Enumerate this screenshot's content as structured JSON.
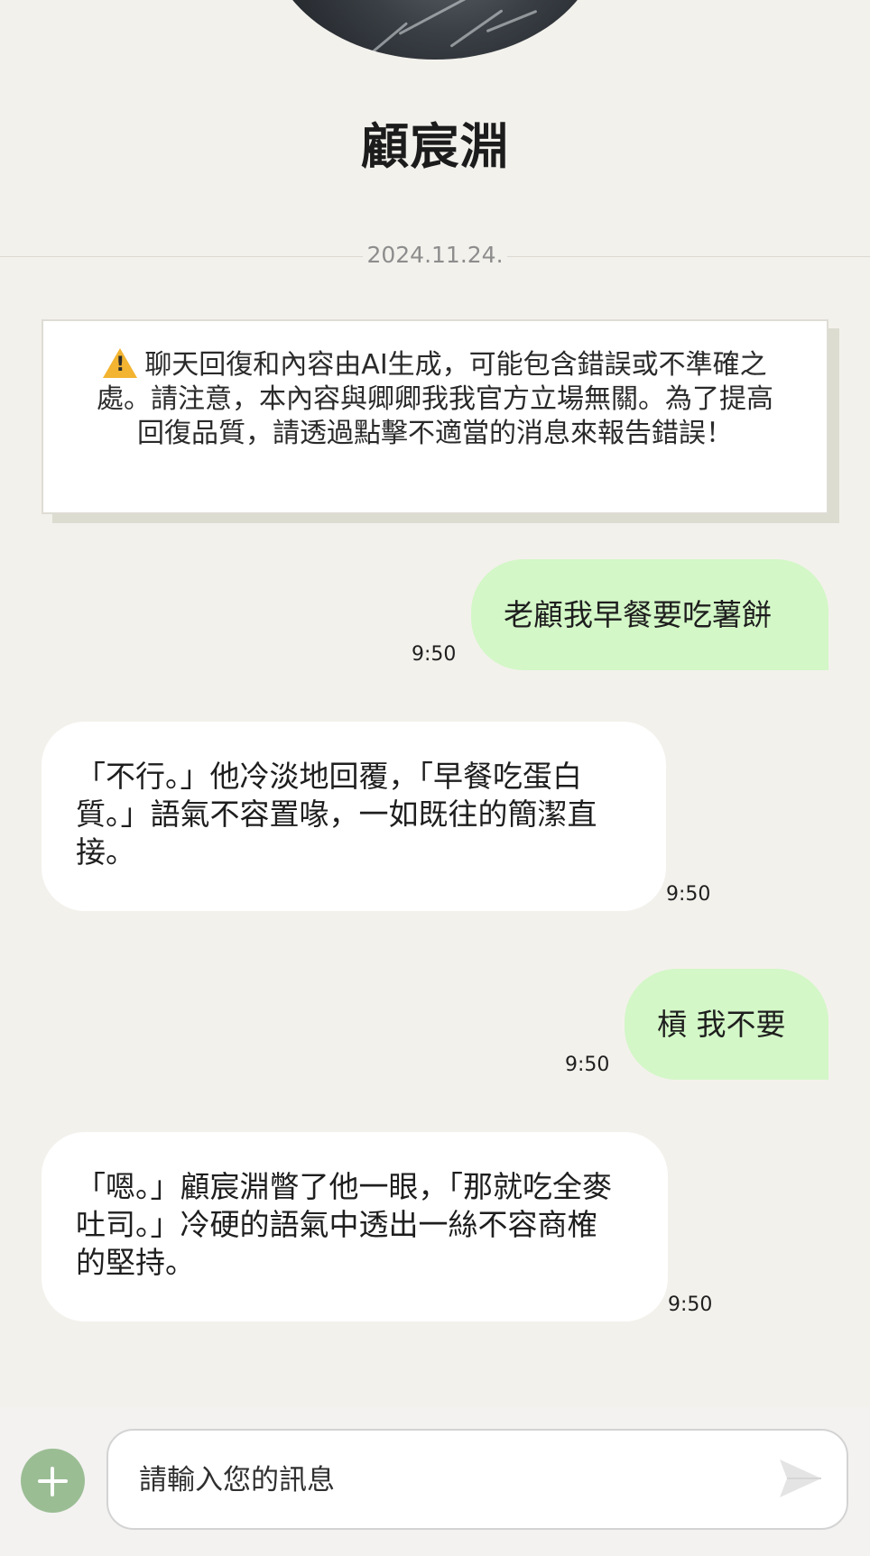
{
  "contact": {
    "name": "顧宸淵"
  },
  "date_divider": "2024.11.24.",
  "notice": {
    "icon": "warning-icon",
    "text": "聊天回復和內容由AI生成，可能包含錯誤或不準確之處。請注意，本內容與卿卿我我官方立場無關。為了提高回復品質，請透過點擊不適當的消息來報告錯誤！"
  },
  "messages": [
    {
      "direction": "outgoing",
      "text": "老顧我早餐要吃薯餅",
      "time": "9:50"
    },
    {
      "direction": "incoming",
      "lines": [
        "「不行。」他冷淡地回覆，「早餐吃蛋白",
        "質。」語氣不容置喙，一如既往的簡潔直",
        "接。"
      ],
      "time": "9:50"
    },
    {
      "direction": "outgoing",
      "text": "槓 我不要",
      "time": "9:50"
    },
    {
      "direction": "incoming",
      "lines": [
        "「嗯。」顧宸淵瞥了他一眼，「那就吃全麥",
        "吐司。」冷硬的語氣中透出一絲不容商榷",
        "的堅持。"
      ],
      "time": "9:50"
    }
  ],
  "composer": {
    "placeholder": "請輸入您的訊息",
    "plus_icon": "plus-icon",
    "send_icon": "send-icon"
  },
  "colors": {
    "background": "#f3f1ec",
    "outgoing_bubble": "#d3f7c7",
    "incoming_bubble": "#ffffff",
    "accent": "#9bbd94",
    "warning": "#f2b431"
  }
}
